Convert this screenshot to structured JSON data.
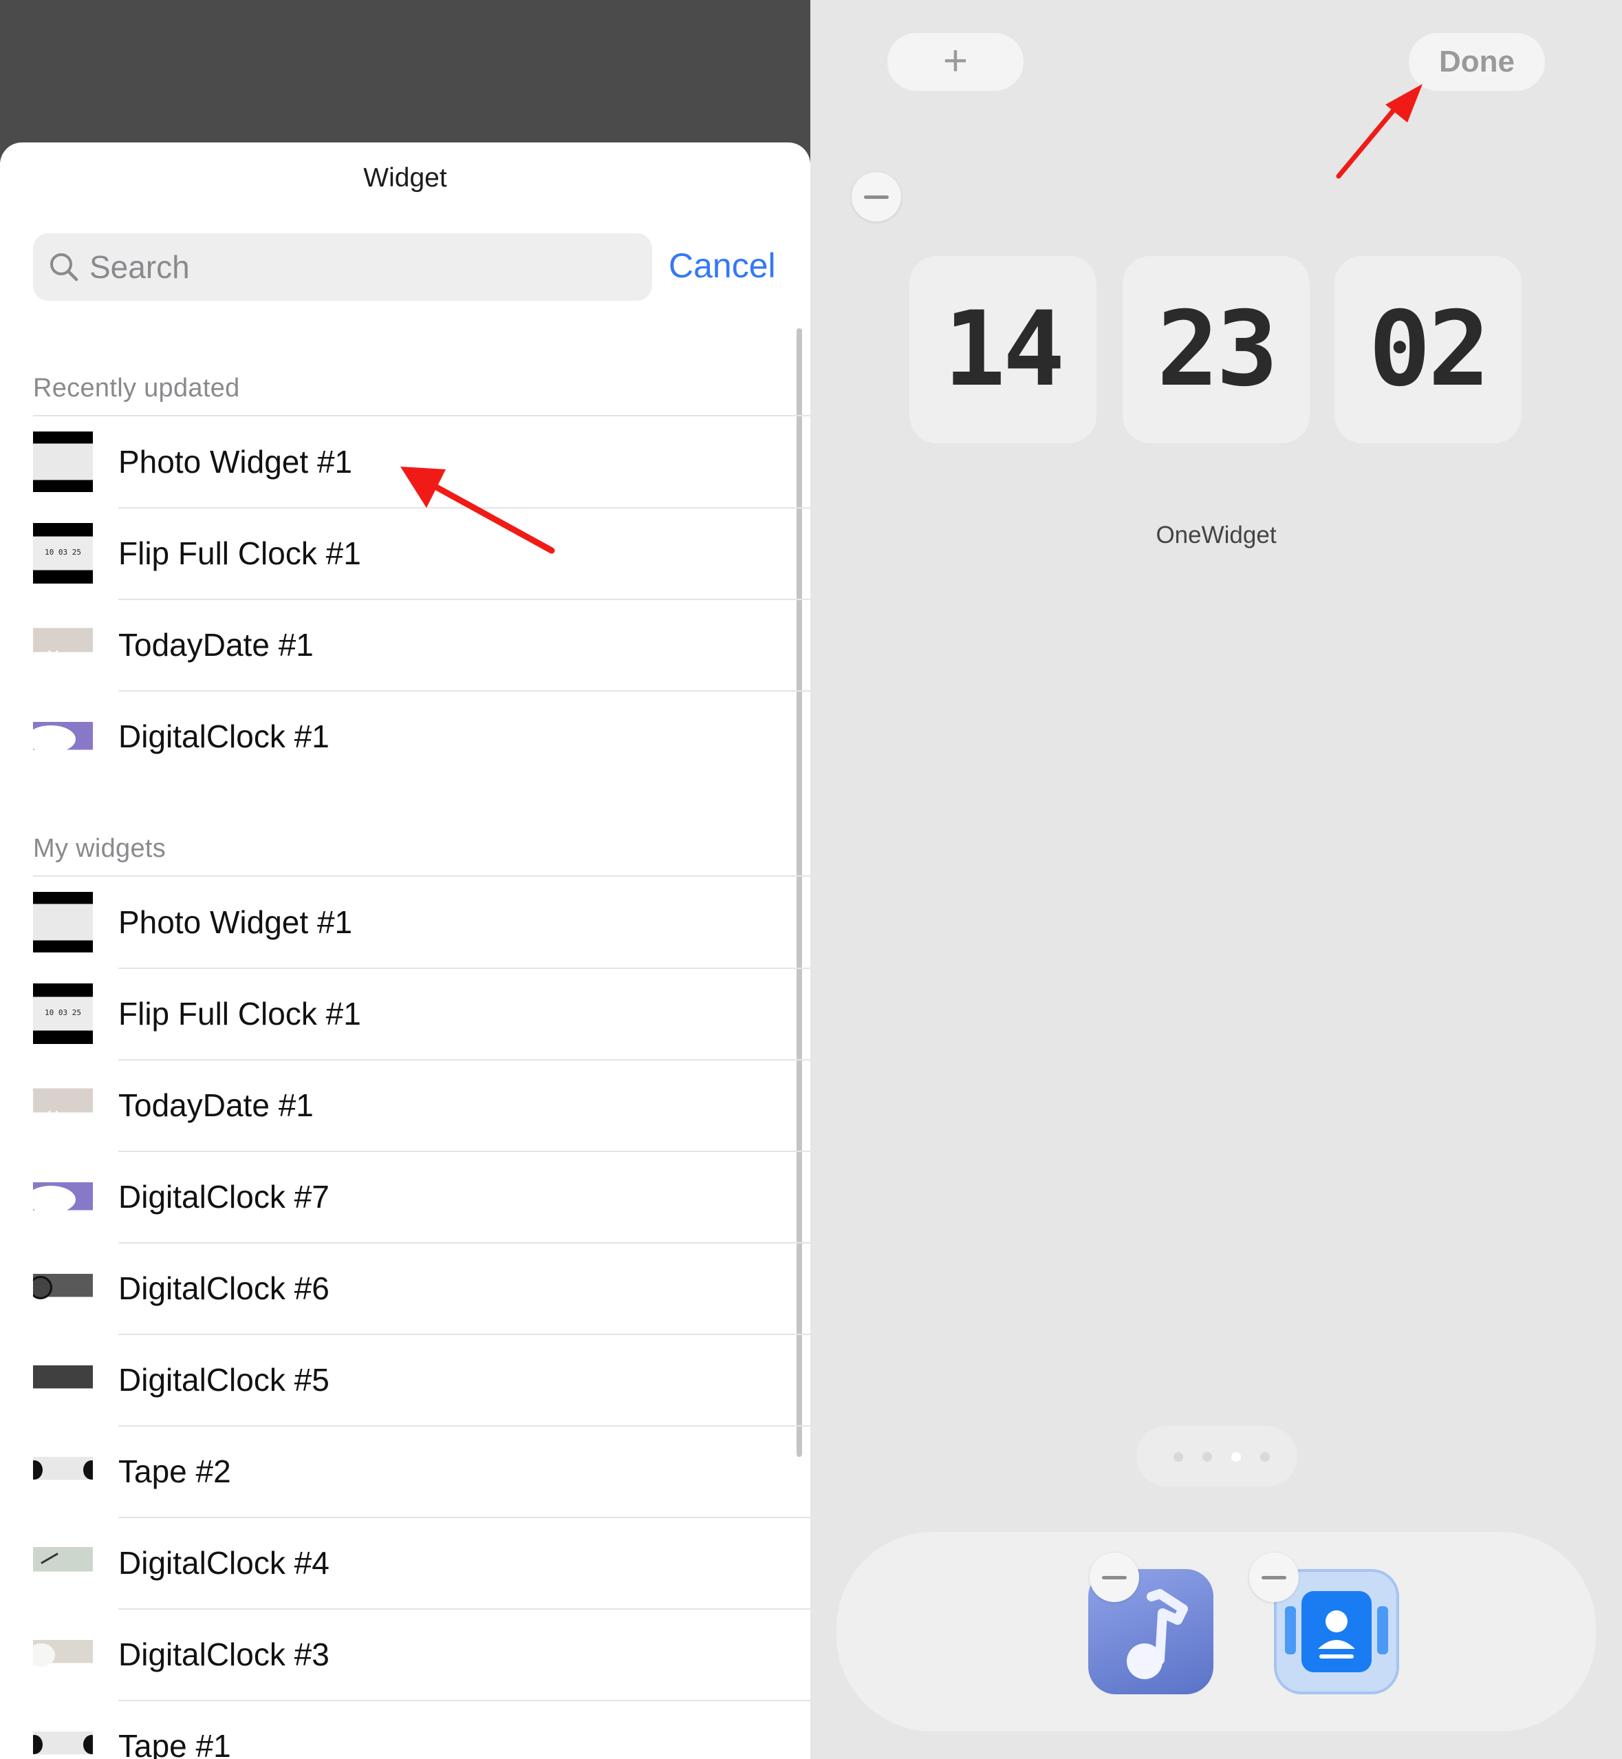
{
  "sheet": {
    "title": "Widget",
    "search_placeholder": "Search",
    "cancel_label": "Cancel"
  },
  "recently_updated": {
    "header": "Recently updated",
    "items": [
      {
        "label": "Photo Widget #1",
        "thumb": "photo"
      },
      {
        "label": "Flip Full Clock #1",
        "thumb": "flip"
      },
      {
        "label": "TodayDate #1",
        "thumb": "today"
      },
      {
        "label": "DigitalClock #1",
        "thumb": "purple"
      }
    ]
  },
  "my_widgets": {
    "header": "My widgets",
    "items": [
      {
        "label": "Photo Widget #1",
        "thumb": "photo"
      },
      {
        "label": "Flip Full Clock #1",
        "thumb": "flip"
      },
      {
        "label": "TodayDate #1",
        "thumb": "today"
      },
      {
        "label": "DigitalClock #7",
        "thumb": "purple"
      },
      {
        "label": "DigitalClock #6",
        "thumb": "dark"
      },
      {
        "label": "DigitalClock #5",
        "thumb": "dark2"
      },
      {
        "label": "Tape #2",
        "thumb": "tape"
      },
      {
        "label": "DigitalClock #4",
        "thumb": "green"
      },
      {
        "label": "DigitalClock #3",
        "thumb": "beige"
      },
      {
        "label": "Tape #1",
        "thumb": "tape"
      }
    ]
  },
  "thumb_text": {
    "flip": "10 03 25",
    "today": "14"
  },
  "editor": {
    "add_label": "+",
    "done_label": "Done",
    "clock": {
      "hours": "14",
      "minutes": "23",
      "seconds": "02"
    },
    "widget_caption": "OneWidget",
    "page_dots": {
      "count": 4,
      "active_index": 2
    },
    "dock_apps": [
      {
        "name": "music-app-icon"
      },
      {
        "name": "contacts-app-icon"
      }
    ]
  },
  "annotations": {
    "arrow_color": "#f01b16"
  },
  "colors": {
    "accent": "#3478f6",
    "overlay": "#4b4b4b",
    "editor_bg": "#e6e6e7"
  }
}
